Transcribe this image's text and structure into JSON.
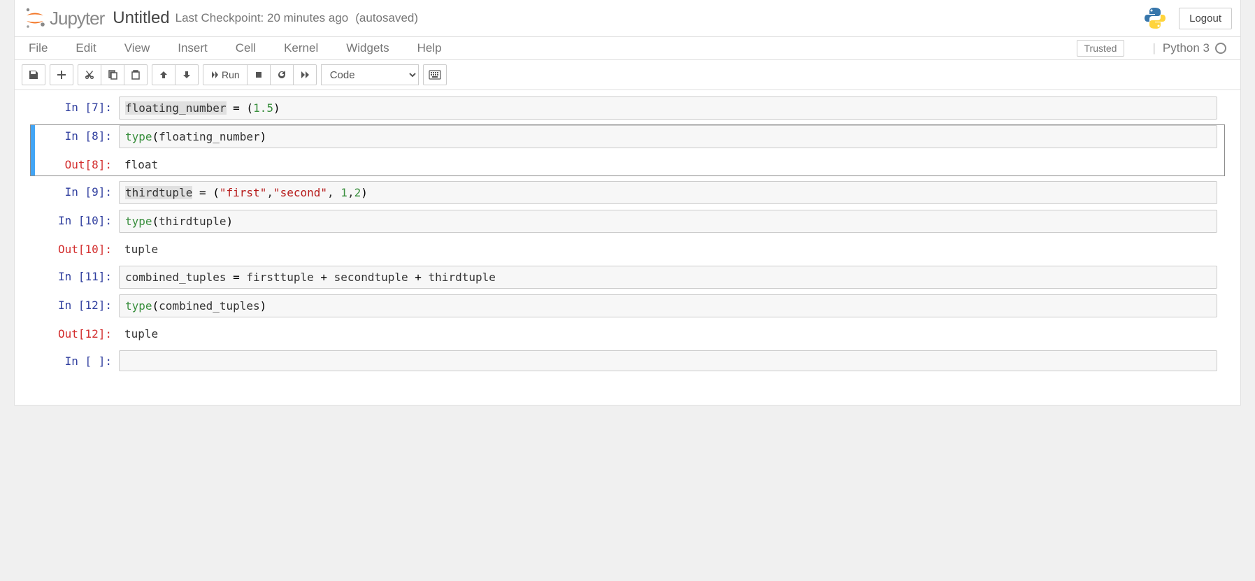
{
  "header": {
    "logo_text": "Jupyter",
    "title": "Untitled",
    "checkpoint": "Last Checkpoint: 20 minutes ago",
    "autosave": "(autosaved)",
    "logout": "Logout"
  },
  "menubar": {
    "items": [
      "File",
      "Edit",
      "View",
      "Insert",
      "Cell",
      "Kernel",
      "Widgets",
      "Help"
    ],
    "trusted": "Trusted",
    "kernel_name": "Python 3"
  },
  "toolbar": {
    "run_label": "Run",
    "cell_type": "Code"
  },
  "cells": [
    {
      "in_prompt": "In [7]:",
      "out_prompt": "",
      "output": "",
      "code_tokens": [
        {
          "t": "floating_number",
          "c": "c-id"
        },
        {
          "t": " ",
          "c": ""
        },
        {
          "t": "=",
          "c": "c-op"
        },
        {
          "t": " ",
          "c": ""
        },
        {
          "t": "(",
          "c": "c-par"
        },
        {
          "t": "1.5",
          "c": "c-num"
        },
        {
          "t": ")",
          "c": "c-par"
        }
      ]
    },
    {
      "in_prompt": "In [8]:",
      "out_prompt": "Out[8]:",
      "output": "float",
      "selected": true,
      "code_tokens": [
        {
          "t": "type",
          "c": "c-fn"
        },
        {
          "t": "(",
          "c": "c-par"
        },
        {
          "t": "floating_number",
          "c": ""
        },
        {
          "t": ")",
          "c": "c-par"
        }
      ]
    },
    {
      "in_prompt": "In [9]:",
      "out_prompt": "",
      "output": "",
      "code_tokens": [
        {
          "t": "thirdtuple",
          "c": "c-id"
        },
        {
          "t": " ",
          "c": ""
        },
        {
          "t": "=",
          "c": "c-op"
        },
        {
          "t": " ",
          "c": ""
        },
        {
          "t": "(",
          "c": "c-par"
        },
        {
          "t": "\"first\"",
          "c": "c-str"
        },
        {
          "t": ",",
          "c": ""
        },
        {
          "t": "\"second\"",
          "c": "c-str"
        },
        {
          "t": ", ",
          "c": ""
        },
        {
          "t": "1",
          "c": "c-num"
        },
        {
          "t": ",",
          "c": ""
        },
        {
          "t": "2",
          "c": "c-num"
        },
        {
          "t": ")",
          "c": "c-par"
        }
      ]
    },
    {
      "in_prompt": "In [10]:",
      "out_prompt": "Out[10]:",
      "output": "tuple",
      "code_tokens": [
        {
          "t": "type",
          "c": "c-fn"
        },
        {
          "t": "(",
          "c": "c-par"
        },
        {
          "t": "thirdtuple",
          "c": ""
        },
        {
          "t": ")",
          "c": "c-par"
        }
      ]
    },
    {
      "in_prompt": "In [11]:",
      "out_prompt": "",
      "output": "",
      "code_tokens": [
        {
          "t": "combined_tuples",
          "c": ""
        },
        {
          "t": " ",
          "c": ""
        },
        {
          "t": "=",
          "c": "c-op"
        },
        {
          "t": " ",
          "c": ""
        },
        {
          "t": "firsttuple ",
          "c": ""
        },
        {
          "t": "+",
          "c": "c-op"
        },
        {
          "t": " secondtuple ",
          "c": ""
        },
        {
          "t": "+",
          "c": "c-op"
        },
        {
          "t": " thirdtuple",
          "c": ""
        }
      ]
    },
    {
      "in_prompt": "In [12]:",
      "out_prompt": "Out[12]:",
      "output": "tuple",
      "code_tokens": [
        {
          "t": "type",
          "c": "c-fn"
        },
        {
          "t": "(",
          "c": "c-par"
        },
        {
          "t": "combined_tuples",
          "c": ""
        },
        {
          "t": ")",
          "c": "c-par"
        }
      ]
    },
    {
      "in_prompt": "In [ ]:",
      "out_prompt": "",
      "output": "",
      "code_tokens": []
    }
  ]
}
